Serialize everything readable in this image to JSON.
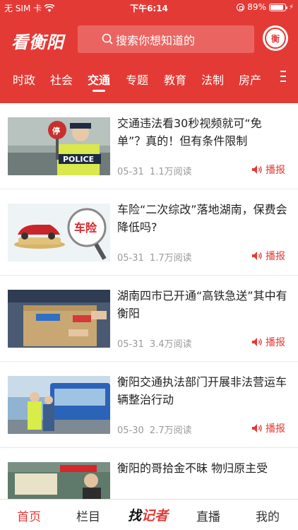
{
  "status": {
    "carrier": "无 SIM 卡",
    "time": "下午6:14",
    "battery_pct": "89%",
    "battery_level": 0.89
  },
  "header": {
    "logo": "看衡阳",
    "search_placeholder": "搜索你想知道的",
    "badge": "衡"
  },
  "tabs": [
    {
      "label": "时政"
    },
    {
      "label": "社会"
    },
    {
      "label": "交通",
      "active": true
    },
    {
      "label": "专题"
    },
    {
      "label": "教育"
    },
    {
      "label": "法制"
    },
    {
      "label": "房产"
    }
  ],
  "news": [
    {
      "title": "交通违法看30秒视频就可“免单”？真的！但有条件限制",
      "date": "05-31",
      "views": "1.1万阅读",
      "play": "播报"
    },
    {
      "title": "车险“二次综改”落地湖南，保费会降低吗?",
      "date": "05-31",
      "views": "1.7万阅读",
      "play": "播报"
    },
    {
      "title": "湖南四市已开通“高铁急送”其中有衡阳",
      "date": "05-31",
      "views": "3.4万阅读",
      "play": "播报"
    },
    {
      "title": "衡阳交通执法部门开展非法营运车辆整治行动",
      "date": "05-30",
      "views": "2.7万阅读",
      "play": "播报"
    },
    {
      "title": "衡阳的哥拾金不昧 物归原主受",
      "date": "",
      "views": "",
      "play": ""
    }
  ],
  "thumb_text": {
    "stop": "停",
    "police": "POLICE",
    "chexian": "车险"
  },
  "bottom_nav": {
    "home": "首页",
    "column": "栏目",
    "brand_a": "找",
    "brand_b": "记者",
    "live": "直播",
    "mine": "我的"
  },
  "colors": {
    "accent": "#e43a35"
  }
}
